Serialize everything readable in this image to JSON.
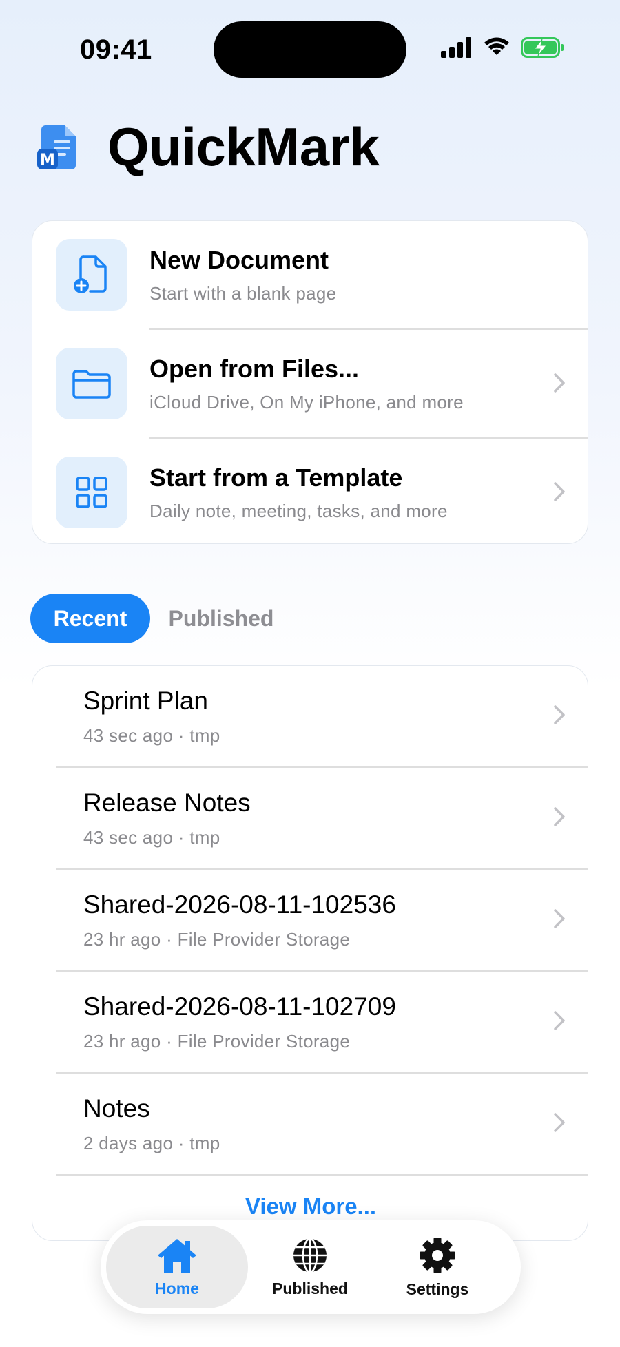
{
  "status_bar": {
    "time": "09:41"
  },
  "app": {
    "title": "QuickMark",
    "logo_letter": "M"
  },
  "actions": [
    {
      "title": "New Document",
      "subtitle": "Start with a blank page",
      "icon": "new-document-icon"
    },
    {
      "title": "Open from Files...",
      "subtitle": "iCloud Drive, On My iPhone, and more",
      "icon": "folder-icon"
    },
    {
      "title": "Start from a Template",
      "subtitle": "Daily note, meeting, tasks, and more",
      "icon": "grid-icon"
    }
  ],
  "tabs": {
    "recent": "Recent",
    "published": "Published",
    "selected": "Recent"
  },
  "recent": [
    {
      "name": "Sprint Plan",
      "meta": "43 sec ago · tmp"
    },
    {
      "name": "Release Notes",
      "meta": "43 sec ago · tmp"
    },
    {
      "name": "Shared-2026-08-11-102536",
      "meta": "23 hr ago · File Provider Storage"
    },
    {
      "name": "Shared-2026-08-11-102709",
      "meta": "23 hr ago · File Provider Storage"
    },
    {
      "name": "Notes",
      "meta": "2 days ago · tmp"
    }
  ],
  "view_more": "View More...",
  "tabbar": {
    "home": "Home",
    "published": "Published",
    "settings": "Settings",
    "selected": "Home"
  },
  "colors": {
    "accent": "#1a84f5",
    "icon_tile": "#e2effc",
    "secondary_text": "#8a8a8e",
    "battery_green": "#34c759"
  }
}
